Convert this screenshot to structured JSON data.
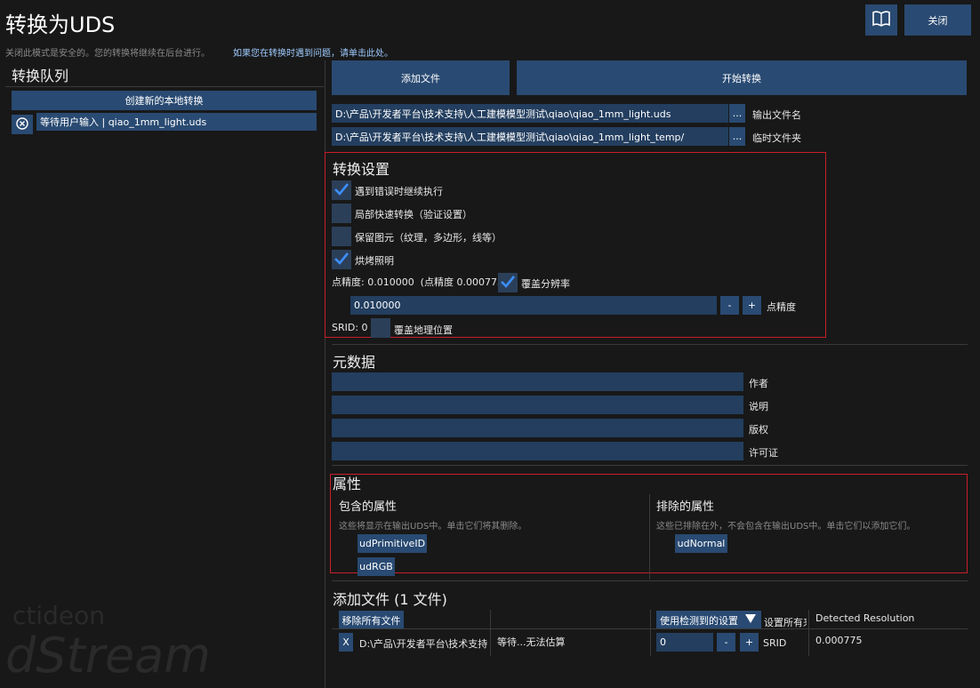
{
  "header": {
    "title": "转换为UDS",
    "info": "关闭此模式是安全的。您的转换将继续在后台进行。",
    "help_link": "如果您在转换时遇到问题，请单击此处。",
    "close_label": "关闭"
  },
  "queue": {
    "title": "转换队列",
    "create_label": "创建新的本地转换",
    "items": [
      {
        "label": "等待用户输入 | qiao_1mm_light.uds"
      }
    ]
  },
  "toolbar": {
    "add_files_label": "添加文件",
    "start_label": "开始转换"
  },
  "paths": {
    "output_value": "D:\\产品\\开发者平台\\技术支持\\人工建模模型测试\\qiao\\qiao_1mm_light.uds",
    "output_label": "输出文件名",
    "temp_value": "D:\\产品\\开发者平台\\技术支持\\人工建模模型测试\\qiao\\qiao_1mm_light_temp/",
    "temp_label": "临时文件夹",
    "browse_label": "..."
  },
  "settings": {
    "title": "转换设置",
    "options": [
      {
        "label": "遇到错误时继续执行",
        "checked": true
      },
      {
        "label": "局部快速转换（验证设置）",
        "checked": false
      },
      {
        "label": "保留图元（纹理，多边形，线等）",
        "checked": false
      },
      {
        "label": "烘烤照明",
        "checked": true
      }
    ],
    "point_precision_text": "点精度: 0.010000  (点精度 0.000775)",
    "override_resolution_label": "覆盖分辨率",
    "override_resolution_checked": true,
    "precision_value": "0.010000",
    "minus_label": "-",
    "plus_label": "+",
    "precision_label": "点精度",
    "srid_text": "SRID: 0",
    "override_geo_label": "覆盖地理位置",
    "override_geo_checked": false
  },
  "metadata": {
    "title": "元数据",
    "fields": [
      {
        "label": "作者",
        "value": ""
      },
      {
        "label": "说明",
        "value": ""
      },
      {
        "label": "版权",
        "value": ""
      },
      {
        "label": "许可证",
        "value": ""
      }
    ]
  },
  "attributes": {
    "title": "属性",
    "included_title": "包含的属性",
    "included_desc": "这些将显示在输出UDS中。单击它们将其删除。",
    "included": [
      "udPrimitiveID",
      "udRGB"
    ],
    "excluded_title": "排除的属性",
    "excluded_desc": "这些已排除在外，不会包含在输出UDS中。单击它们以添加它们。",
    "excluded": [
      "udNormal"
    ]
  },
  "files": {
    "title": "添加文件 (1 文件)",
    "remove_all_label": "移除所有文件",
    "settings_select": "使用检测到的设置",
    "set_all_label": "设置所有来",
    "detected_resolution_header": "Detected Resolution",
    "rows": [
      {
        "remove_label": "X",
        "path": "D:\\产品\\开发者平台\\技术支持\\",
        "status": "等待...无法估算",
        "srid_value": "0",
        "srid_label": "SRID",
        "resolution": "0.000775"
      }
    ]
  },
  "watermark": {
    "brand_top": "ctideon",
    "brand_bottom": "dStream"
  },
  "colors": {
    "background": "#181818",
    "button": "#294a72",
    "field": "#233e5f",
    "highlight_border": "#c81e2a",
    "link": "#9ecbff"
  }
}
